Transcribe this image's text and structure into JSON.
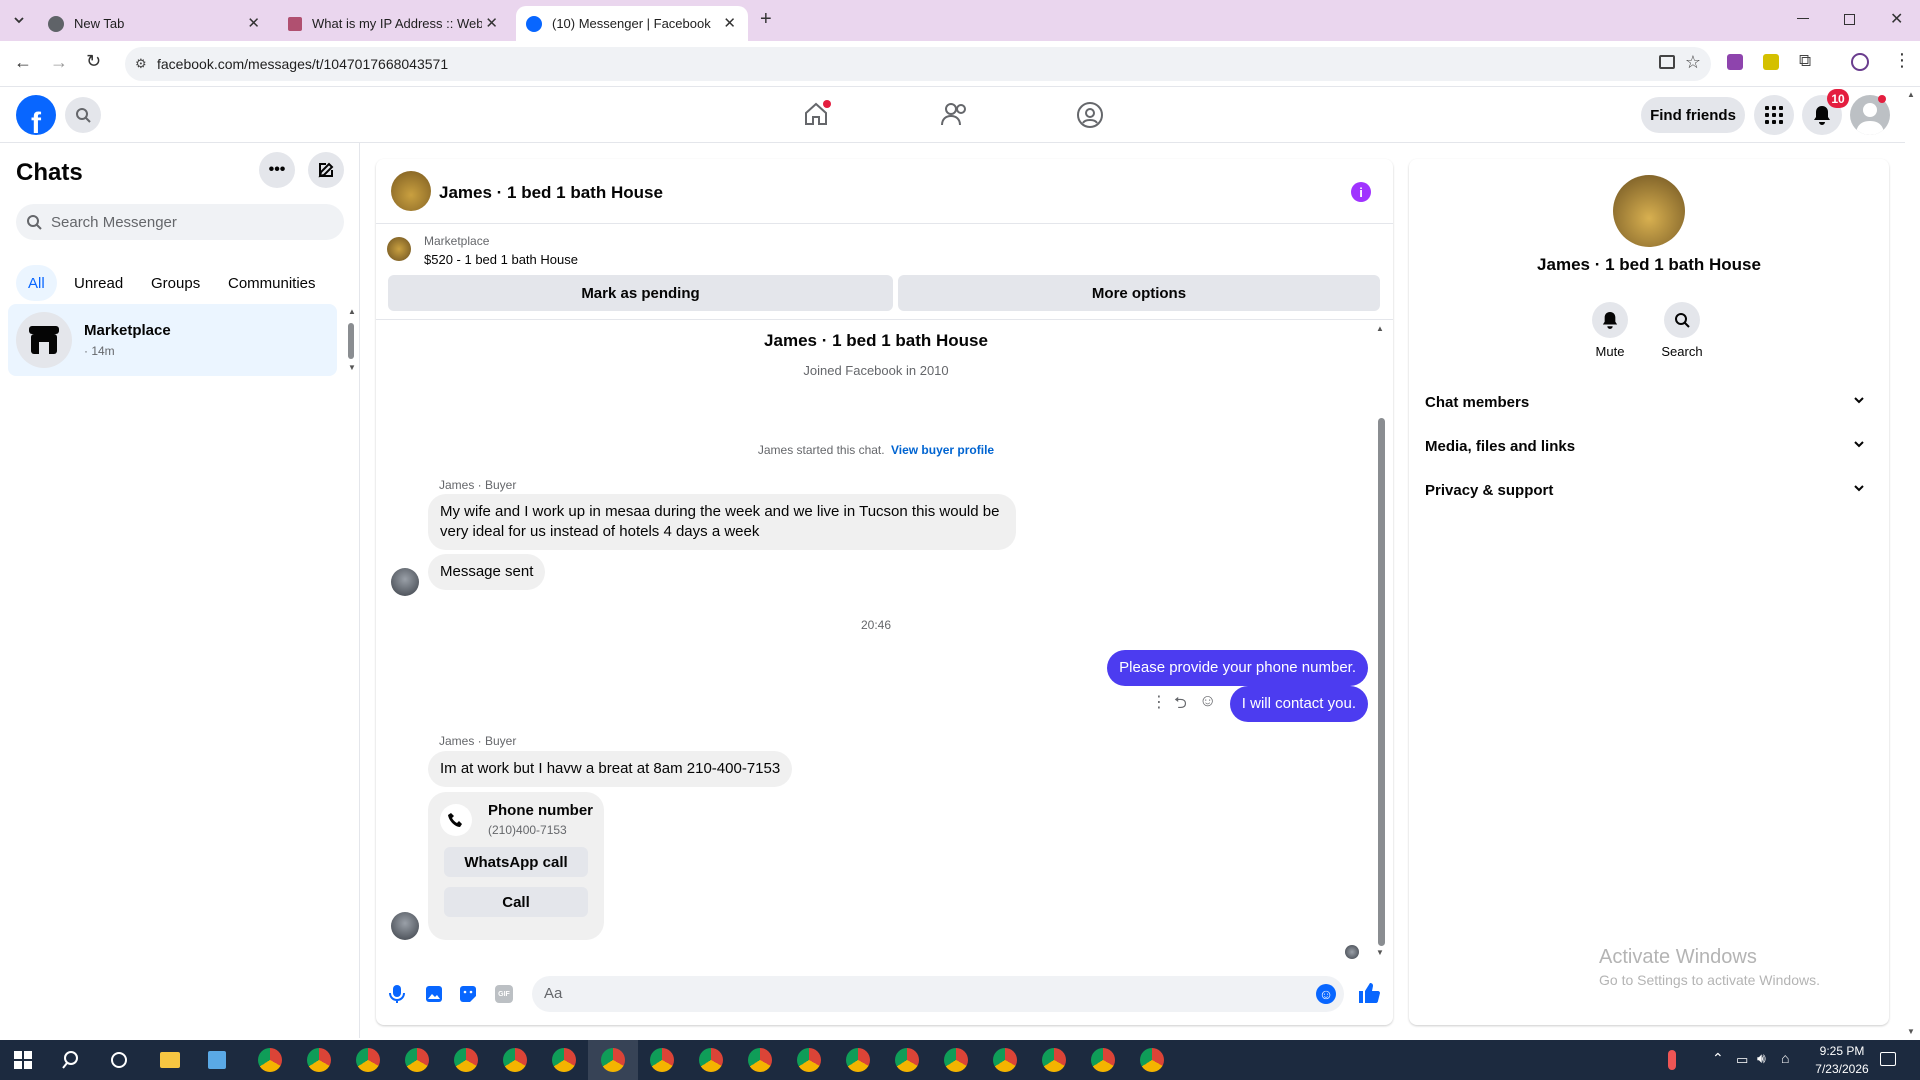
{
  "browser": {
    "tabs": [
      {
        "title": "New Tab"
      },
      {
        "title": "What is my IP Address :: WebBr"
      },
      {
        "title": "(10) Messenger | Facebook"
      }
    ],
    "url": "facebook.com/messages/t/1047017668043571"
  },
  "fb_header": {
    "find_friends": "Find friends",
    "notification_count": "10"
  },
  "chats": {
    "title": "Chats",
    "search_placeholder": "Search Messenger",
    "filters": [
      "All",
      "Unread",
      "Groups",
      "Communities"
    ],
    "items": [
      {
        "name": "Marketplace",
        "time": "· 14m"
      }
    ]
  },
  "conversation": {
    "title": "James · 1 bed 1 bath House",
    "marketplace_label": "Marketplace",
    "listing": "$520 - 1 bed 1 bath House",
    "mark_pending": "Mark as pending",
    "more_options": "More options",
    "profile_name": "James · 1 bed 1 bath House",
    "joined": "Joined Facebook in 2010",
    "started_text": "James started this chat.",
    "view_profile": "View buyer profile",
    "sender_label_1": "James · Buyer",
    "msg1": "My wife and I work up in mesaa during the week and we live in Tucson this would be very ideal for us instead of hotels 4 days a week",
    "msg2": "Message sent",
    "timestamp": "20:46",
    "out1": "Please provide your phone number.",
    "out2": "I will contact you.",
    "sender_label_2": "James · Buyer",
    "msg3": "Im at work but I havw a breat at 8am 210-400-7153",
    "phone_card_title": "Phone number",
    "phone_card_number": "(210)400-7153",
    "whatsapp_call": "WhatsApp call",
    "call": "Call",
    "composer_placeholder": "Aa"
  },
  "details": {
    "name": "James · 1 bed 1 bath House",
    "mute": "Mute",
    "search": "Search",
    "sections": [
      "Chat members",
      "Media, files and links",
      "Privacy & support"
    ]
  },
  "watermark": {
    "line1": "Activate Windows",
    "line2": "Go to Settings to activate Windows."
  },
  "taskbar": {
    "time": "9:25 PM",
    "date": "7/23/2026"
  },
  "colors": {
    "accent": "#0866ff",
    "outgoing": "#4c3cf0",
    "info_icon": "#a033ff",
    "badge": "#e41e3f"
  }
}
